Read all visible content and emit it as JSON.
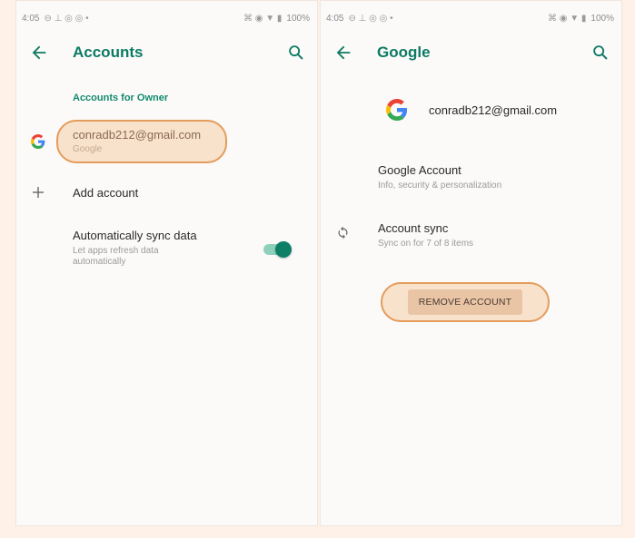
{
  "left_screen": {
    "status_bar": {
      "time": "4:05",
      "battery": "100%"
    },
    "toolbar": {
      "title": "Accounts"
    },
    "section_header": "Accounts for Owner",
    "account": {
      "email": "conradb212@gmail.com",
      "type": "Google"
    },
    "add_account": {
      "label": "Add account"
    },
    "auto_sync": {
      "title": "Automatically sync data",
      "subtitle_line1": "Let apps refresh data",
      "subtitle_line2": "automatically",
      "enabled": true
    }
  },
  "right_screen": {
    "status_bar": {
      "time": "4:05",
      "battery": "100%"
    },
    "toolbar": {
      "title": "Google"
    },
    "account_header": {
      "email": "conradb212@gmail.com"
    },
    "google_account": {
      "title": "Google Account",
      "subtitle": "Info, security & personalization"
    },
    "account_sync": {
      "title": "Account sync",
      "subtitle": "Sync on for 7 of 8 items"
    },
    "remove_account": {
      "label": "REMOVE ACCOUNT"
    }
  },
  "colors": {
    "accent": "#0d7a63",
    "highlight_border": "#e49c5d",
    "background": "#fdf1e8"
  }
}
